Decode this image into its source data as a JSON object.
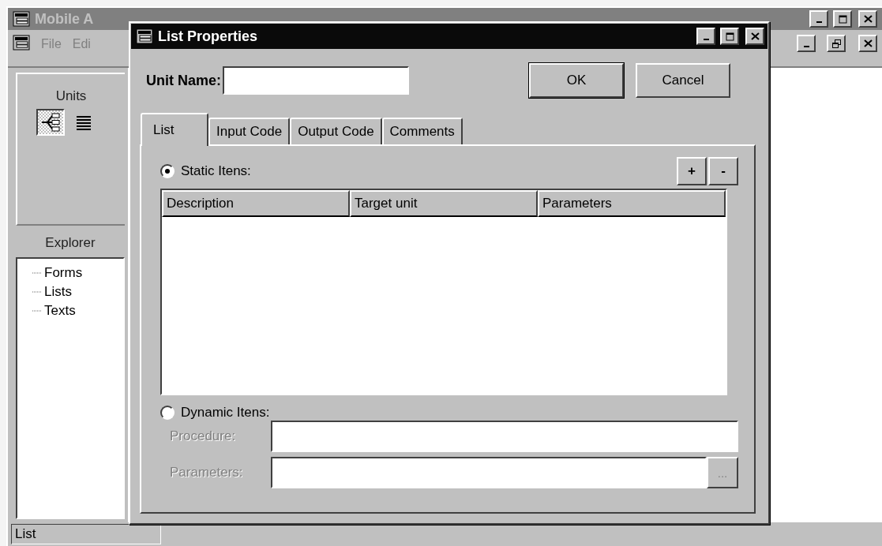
{
  "main_window": {
    "title": "Mobile A",
    "menu": [
      {
        "label": "File"
      },
      {
        "label": "Edi"
      }
    ],
    "units_panel": {
      "title": "Units",
      "tools": [
        {
          "kind": "tree",
          "selected": true
        },
        {
          "kind": "list",
          "selected": false
        }
      ]
    },
    "explorer": {
      "title": "Explorer",
      "items": [
        {
          "label": "Forms"
        },
        {
          "label": "Lists"
        },
        {
          "label": "Texts"
        }
      ]
    },
    "status_bar": "List"
  },
  "dialog": {
    "title": "List Properties",
    "unit_name_label": "Unit Name:",
    "buttons": [
      "OK",
      "Cancel"
    ],
    "tabs": [
      {
        "label": "List",
        "selected": true
      },
      {
        "label": "Input Code",
        "selected": false
      },
      {
        "label": "Output Code",
        "selected": false
      },
      {
        "label": "Comments",
        "selected": false
      }
    ],
    "static_items": {
      "label": "Static Itens:",
      "selected": true
    },
    "list_buttons": [
      "+",
      "-"
    ],
    "columns": [
      "Description",
      "Target unit",
      "Parameters"
    ],
    "dynamic_items": {
      "label": "Dynamic Itens:",
      "selected": false
    },
    "procedure": {
      "label": "Procedure:",
      "disabled": true
    },
    "parameters": {
      "label": "Parameters:",
      "disabled": true,
      "browse": "..."
    }
  }
}
